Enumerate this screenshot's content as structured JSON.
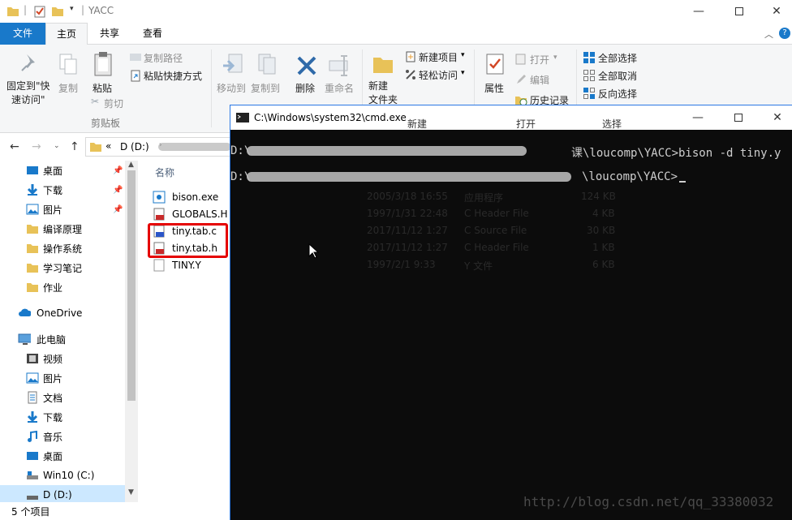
{
  "explorer": {
    "window_title": "YACC",
    "tabs": {
      "file": "文件",
      "home": "主页",
      "share": "共享",
      "view": "查看"
    },
    "ribbon": {
      "pin_quick_access": "固定到\"快\n速访问\"",
      "copy": "复制",
      "paste": "粘贴",
      "copy_path": "复制路径",
      "paste_shortcut": "粘贴快捷方式",
      "cut": "剪切",
      "clipboard_group": "剪贴板",
      "move_to": "移动到",
      "copy_to": "复制到",
      "delete": "删除",
      "rename": "重命名",
      "new_folder": "新建\n文件夹",
      "new_item": "新建项目",
      "easy_access": "轻松访问",
      "properties": "属性",
      "open": "打开",
      "edit": "编辑",
      "history": "历史记录",
      "select_all": "全部选择",
      "select_none": "全部取消",
      "invert_selection": "反向选择",
      "new_group": "新建",
      "open_group": "打开",
      "select_group": "选择"
    },
    "address": {
      "prefix": "«",
      "drive": "D (D:)"
    },
    "nav": [
      {
        "label": "桌面",
        "icon": "desktop-icon",
        "pinned": true
      },
      {
        "label": "下载",
        "icon": "download-icon",
        "pinned": true
      },
      {
        "label": "图片",
        "icon": "pictures-icon",
        "pinned": true
      },
      {
        "label": "编译原理",
        "icon": "folder-icon"
      },
      {
        "label": "操作系统",
        "icon": "folder-icon"
      },
      {
        "label": "学习笔记",
        "icon": "folder-icon"
      },
      {
        "label": "作业",
        "icon": "folder-icon"
      },
      {
        "label": "OneDrive",
        "icon": "onedrive-icon"
      },
      {
        "label": "此电脑",
        "icon": "pc-icon"
      },
      {
        "label": "视频",
        "icon": "video-icon"
      },
      {
        "label": "图片",
        "icon": "pictures-icon"
      },
      {
        "label": "文档",
        "icon": "documents-icon"
      },
      {
        "label": "下载",
        "icon": "download-icon"
      },
      {
        "label": "音乐",
        "icon": "music-icon"
      },
      {
        "label": "桌面",
        "icon": "desktop-icon"
      },
      {
        "label": "Win10 (C:)",
        "icon": "drive-c-icon"
      },
      {
        "label": "D (D:)",
        "icon": "drive-d-icon"
      }
    ],
    "column_name": "名称",
    "files": [
      {
        "name": "bison.exe",
        "date": "2005/3/18 16:55",
        "type": "应用程序",
        "size": "124 KB"
      },
      {
        "name": "GLOBALS.H",
        "date": "1997/1/31 22:48",
        "type": "C Header File",
        "size": "4 KB"
      },
      {
        "name": "tiny.tab.c",
        "date": "2017/11/12 1:27",
        "type": "C Source File",
        "size": "30 KB"
      },
      {
        "name": "tiny.tab.h",
        "date": "2017/11/12 1:27",
        "type": "C Header File",
        "size": "1 KB"
      },
      {
        "name": "TINY.Y",
        "date": "1997/2/1 9:33",
        "type": "Y 文件",
        "size": "6 KB"
      }
    ],
    "status": "5 个项目"
  },
  "cmd": {
    "title": "C:\\Windows\\system32\\cmd.exe",
    "line1_prefix": "D:\\",
    "line1_suffix": "课\\loucomp\\YACC>bison -d tiny.y",
    "line2_prefix": "D:\\",
    "line2_suffix": "\\loucomp\\YACC>",
    "watermark": "http://blog.csdn.net/qq_33380032"
  },
  "colors": {
    "accent": "#1979ca",
    "highlight_box": "#e50000",
    "cmd_bg": "#0c0c0c"
  }
}
